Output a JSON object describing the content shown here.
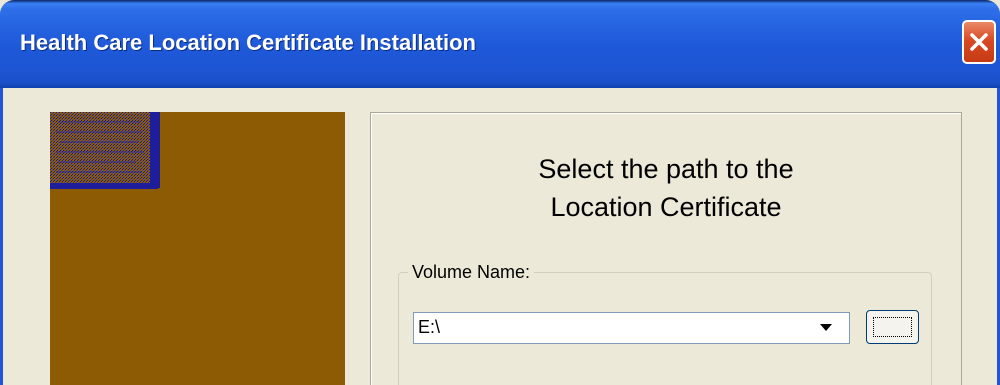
{
  "window": {
    "title": "Health Care Location Certificate Installation",
    "close_icon": "close-icon"
  },
  "panel": {
    "heading_line1": "Select the path to the",
    "heading_line2": "Location Certificate"
  },
  "volume": {
    "legend": "Volume Name:",
    "value": "E:\\",
    "dropdown_icon": "chevron-down-icon",
    "browse_label": "..."
  },
  "colors": {
    "titlebar": "#2563E0",
    "close_button": "#D84A24",
    "image_panel": "#8E5B05",
    "dialog_bg": "#ECE9D8"
  }
}
